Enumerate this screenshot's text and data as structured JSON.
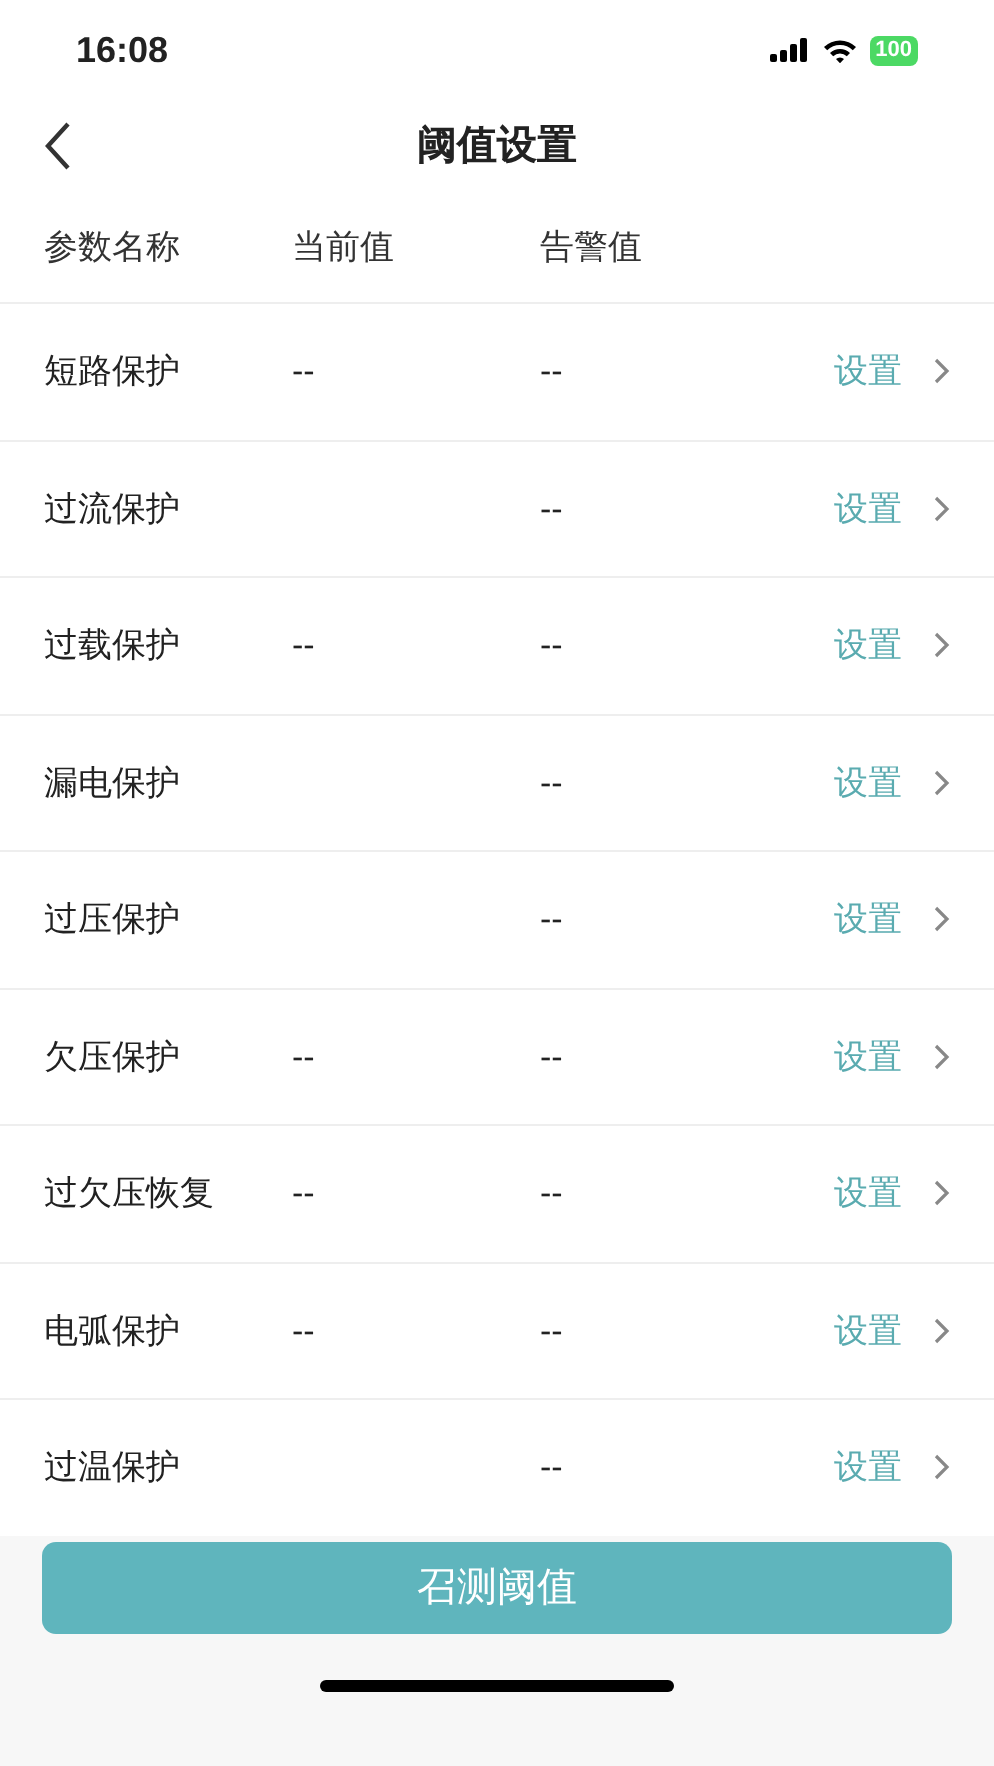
{
  "status_bar": {
    "time": "16:08",
    "battery": "100"
  },
  "nav": {
    "title": "阈值设置"
  },
  "table": {
    "columns": [
      "参数名称",
      "当前值",
      "告警值"
    ],
    "rows": [
      {
        "name": "短路保护",
        "current": "--",
        "alarm": "--",
        "action": "设置"
      },
      {
        "name": "过流保护",
        "alarm": "--",
        "action": "设置"
      },
      {
        "name": "过载保护",
        "current": "--",
        "alarm": "--",
        "action": "设置"
      },
      {
        "name": "漏电保护",
        "alarm": "--",
        "action": "设置"
      },
      {
        "name": "过压保护",
        "alarm": "--",
        "action": "设置"
      },
      {
        "name": "欠压保护",
        "current": "--",
        "alarm": "--",
        "action": "设置"
      },
      {
        "name": "过欠压恢复",
        "current": "--",
        "alarm": "--",
        "action": "设置"
      },
      {
        "name": "电弧保护",
        "current": "--",
        "alarm": "--",
        "action": "设置"
      },
      {
        "name": "过温保护",
        "alarm": "--",
        "action": "设置"
      }
    ]
  },
  "bottom_button": "召测阈值"
}
